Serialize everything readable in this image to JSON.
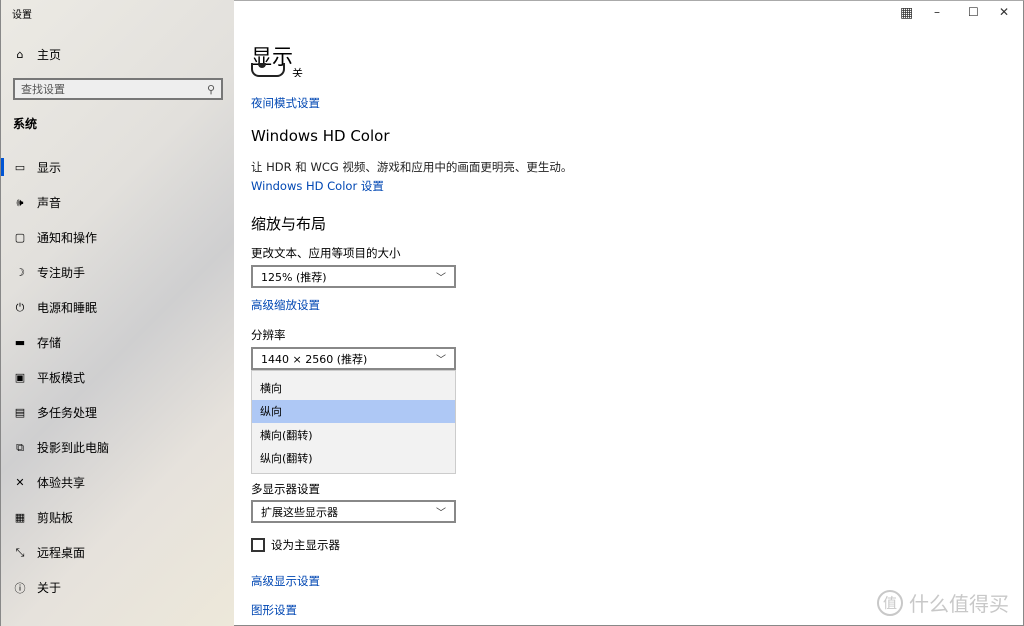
{
  "window": {
    "title": "设置",
    "controls": {
      "minimize": "–",
      "maximize": "☐",
      "close": "✕"
    }
  },
  "sidebar": {
    "home": "主页",
    "search_placeholder": "查找设置",
    "section": "系统",
    "items": [
      {
        "label": "显示",
        "icon": "monitor-icon",
        "glyph": "▭",
        "active": true
      },
      {
        "label": "声音",
        "icon": "speaker-icon",
        "glyph": "🕪"
      },
      {
        "label": "通知和操作",
        "icon": "notification-icon",
        "glyph": "▢"
      },
      {
        "label": "专注助手",
        "icon": "moon-icon",
        "glyph": "☽"
      },
      {
        "label": "电源和睡眠",
        "icon": "power-icon",
        "glyph": "⏻"
      },
      {
        "label": "存储",
        "icon": "storage-icon",
        "glyph": "▬"
      },
      {
        "label": "平板模式",
        "icon": "tablet-icon",
        "glyph": "▣"
      },
      {
        "label": "多任务处理",
        "icon": "multitask-icon",
        "glyph": "▤"
      },
      {
        "label": "投影到此电脑",
        "icon": "project-icon",
        "glyph": "⧉"
      },
      {
        "label": "体验共享",
        "icon": "share-icon",
        "glyph": "✕"
      },
      {
        "label": "剪贴板",
        "icon": "clipboard-icon",
        "glyph": "▦"
      },
      {
        "label": "远程桌面",
        "icon": "remote-icon",
        "glyph": "⤡"
      },
      {
        "label": "关于",
        "icon": "info-icon",
        "glyph": "ⓘ"
      }
    ]
  },
  "main": {
    "title": "显示",
    "night_toggle_state": "关",
    "night_link": "夜间模式设置",
    "hd_title": "Windows HD Color",
    "hd_desc": "让 HDR 和 WCG 视频、游戏和应用中的画面更明亮、更生动。",
    "hd_link": "Windows HD Color 设置",
    "scale_title": "缩放与布局",
    "scale_label": "更改文本、应用等项目的大小",
    "scale_value": "125% (推荐)",
    "scale_link": "高级缩放设置",
    "res_label": "分辨率",
    "res_value": "1440 × 2560 (推荐)",
    "orientation_options": [
      "横向",
      "纵向",
      "横向(翻转)",
      "纵向(翻转)"
    ],
    "orientation_selected": "纵向",
    "multi_label": "多显示器设置",
    "multi_value": "扩展这些显示器",
    "primary_checkbox": "设为主显示器",
    "primary_checked": false,
    "adv_display_link": "高级显示设置",
    "graphics_link": "图形设置"
  },
  "watermark": {
    "badge": "值",
    "text": "什么值得买"
  }
}
